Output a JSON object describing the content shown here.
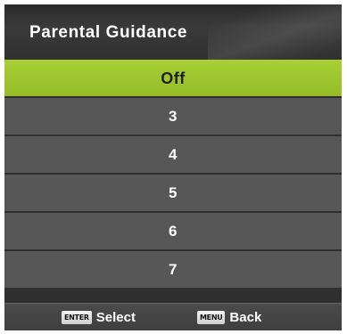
{
  "menu": {
    "title": "Parental Guidance",
    "selected_index": 0,
    "items": [
      {
        "label": "Off"
      },
      {
        "label": "3"
      },
      {
        "label": "4"
      },
      {
        "label": "5"
      },
      {
        "label": "6"
      },
      {
        "label": "7"
      }
    ]
  },
  "footer": {
    "hints": [
      {
        "key": "ENTER",
        "label": "Select"
      },
      {
        "key": "MENU",
        "label": "Back"
      }
    ]
  },
  "colors": {
    "selected": "#a8cf34",
    "item_bg": "#575757",
    "panel_bg": "#2f2f2f"
  }
}
